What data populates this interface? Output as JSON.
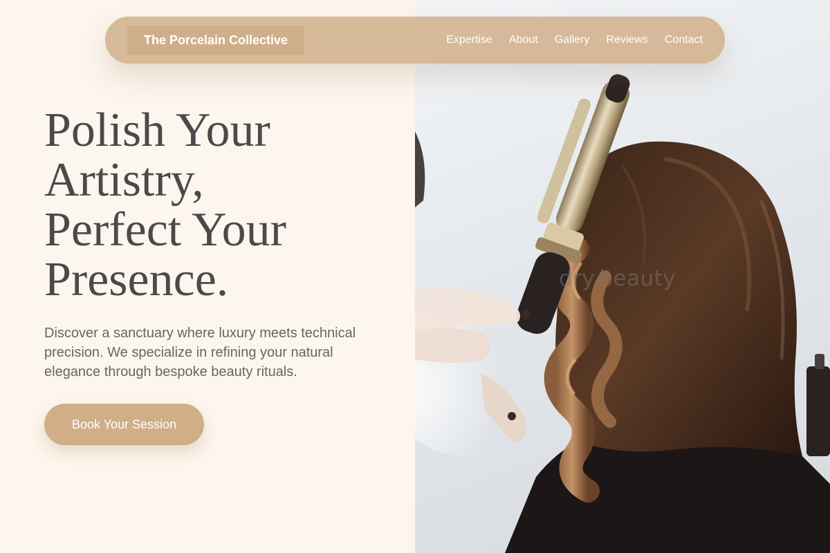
{
  "nav": {
    "brand": "The Porcelain Collective",
    "links": [
      "Expertise",
      "About",
      "Gallery",
      "Reviews",
      "Contact"
    ]
  },
  "hero": {
    "title_lines": [
      "Polish Your",
      "Artistry,",
      "Perfect Your",
      "Presence."
    ],
    "subtitle": "Discover a sanctuary where luxury meets technical precision. We specialize in refining your natural elegance through bespoke beauty rituals.",
    "cta_label": "Book Your Session"
  },
  "photo": {
    "watermark": "dry.beauty",
    "subject": "stylist curling long brown hair with a curling iron"
  },
  "colors": {
    "background": "#fdf6ee",
    "accent": "#d0ae88",
    "nav": "#d4b592",
    "heading": "#4a4a4a",
    "body_text": "#686461"
  }
}
